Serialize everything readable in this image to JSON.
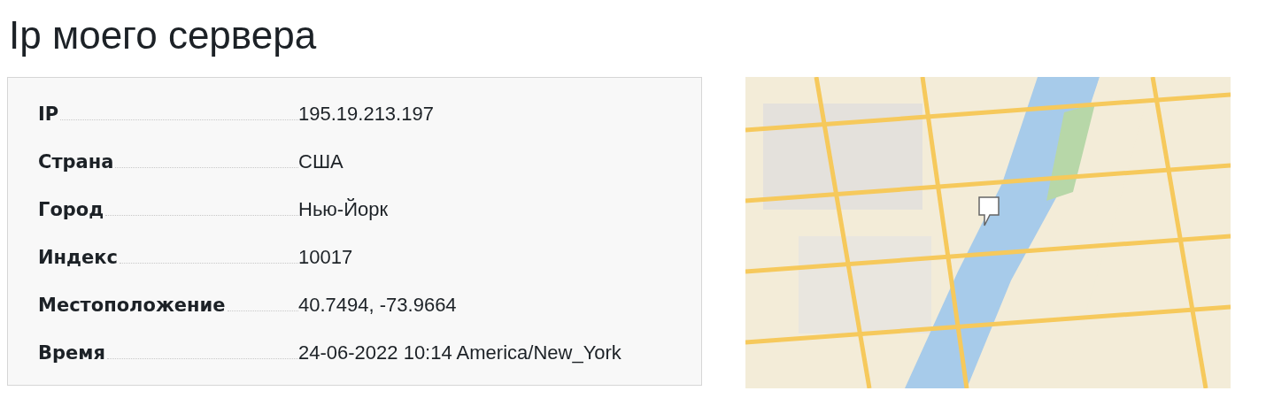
{
  "title": "Ip моего сервера",
  "info": [
    {
      "label": "IP",
      "value": "195.19.213.197"
    },
    {
      "label": "Страна",
      "value": "США"
    },
    {
      "label": "Город",
      "value": "Нью-Йорк"
    },
    {
      "label": "Индекс",
      "value": "10017"
    },
    {
      "label": "Местоположение",
      "value": "40.7494, -73.9664"
    },
    {
      "label": "Время",
      "value": "24-06-2022 10:14 America/New_York"
    }
  ]
}
